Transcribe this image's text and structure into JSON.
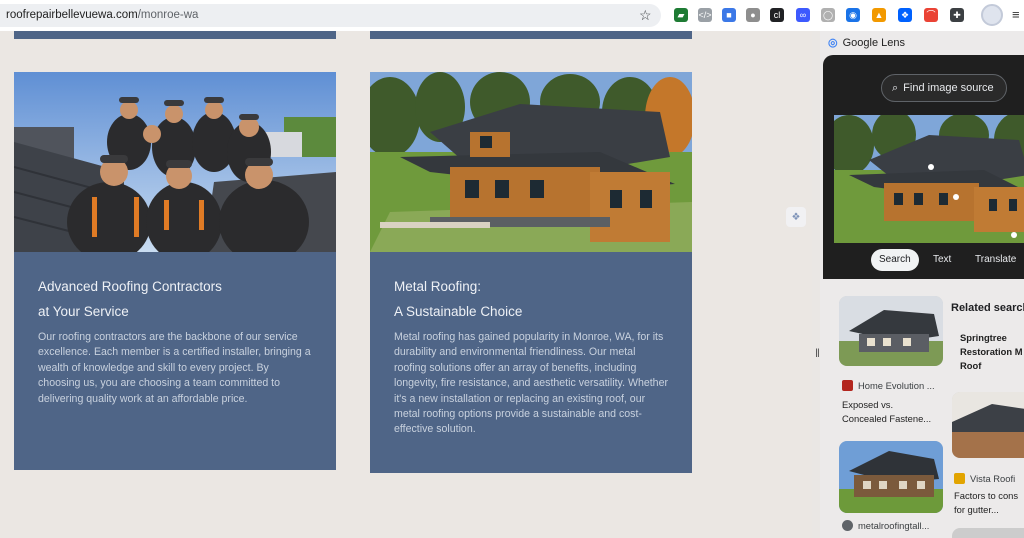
{
  "browser": {
    "url_host": "roofrepairbellevuewa.com",
    "url_path": "/monroe-wa",
    "star_glyph": "☆",
    "extensions": [
      {
        "name": "extension-1-icon",
        "color": "#1e7b34",
        "glyph": "▰"
      },
      {
        "name": "extension-2-icon",
        "color": "#9aa0a6",
        "glyph": "</>"
      },
      {
        "name": "extension-3-icon",
        "color": "#3b78e7",
        "glyph": "■"
      },
      {
        "name": "extension-4-icon",
        "color": "#8e8e8e",
        "glyph": "●"
      },
      {
        "name": "extension-5-icon",
        "color": "#202124",
        "glyph": "cl"
      },
      {
        "name": "extension-6-icon",
        "color": "#3d5afe",
        "glyph": "∞"
      },
      {
        "name": "extension-7-icon",
        "color": "#b0b0b0",
        "glyph": "◯"
      },
      {
        "name": "extension-8-icon",
        "color": "#1a73e8",
        "glyph": "◉"
      },
      {
        "name": "extension-9-icon",
        "color": "#f29900",
        "glyph": "▲"
      },
      {
        "name": "dropbox-icon",
        "color": "#0061fe",
        "glyph": "❖"
      },
      {
        "name": "extension-11-icon",
        "color": "#ea4335",
        "glyph": "⌒"
      },
      {
        "name": "puzzle-icon",
        "color": "#3c4043",
        "glyph": "✚"
      }
    ],
    "menu_glyph": "≡"
  },
  "cards": [
    {
      "title_line1": "Advanced Roofing Contractors",
      "title_line2": "at Your Service",
      "body": "Our roofing contractors are the backbone of our service excellence. Each member is a certified installer, bringing a wealth of knowledge and skill to every project. By choosing us, you are choosing a team committed to delivering quality work at an affordable price."
    },
    {
      "title_line1": "Metal Roofing:",
      "title_line2": "A Sustainable Choice",
      "body": "Metal roofing has gained popularity in Monroe, WA, for its durability and environmental friendliness. Our metal roofing solutions offer an array of benefits, including longevity, fire resistance, and aesthetic versatility. Whether it's a new installation or replacing an existing roof, our metal roofing options provide a sustainable and cost-effective solution."
    }
  ],
  "lens": {
    "header": "Google Lens",
    "find_source": "Find image source",
    "tabs": [
      "Search",
      "Text",
      "Translate"
    ],
    "active_tab": "Search",
    "related_heading": "Related search",
    "related_search_lines": [
      "Springtree",
      "Restoration M",
      "Roof"
    ],
    "results": [
      {
        "source": "Home Evolution ...",
        "title_lines": [
          "Exposed vs.",
          "Concealed Fastene..."
        ],
        "favicon_color": "#b3261e"
      },
      {
        "source": "Vista Roofi",
        "title_lines": [
          "Factors to cons",
          "for gutter..."
        ],
        "favicon_color": "#e2a400"
      },
      {
        "source": "metalroofingtall...",
        "title_lines": [],
        "favicon_color": "#5f6368"
      }
    ]
  }
}
